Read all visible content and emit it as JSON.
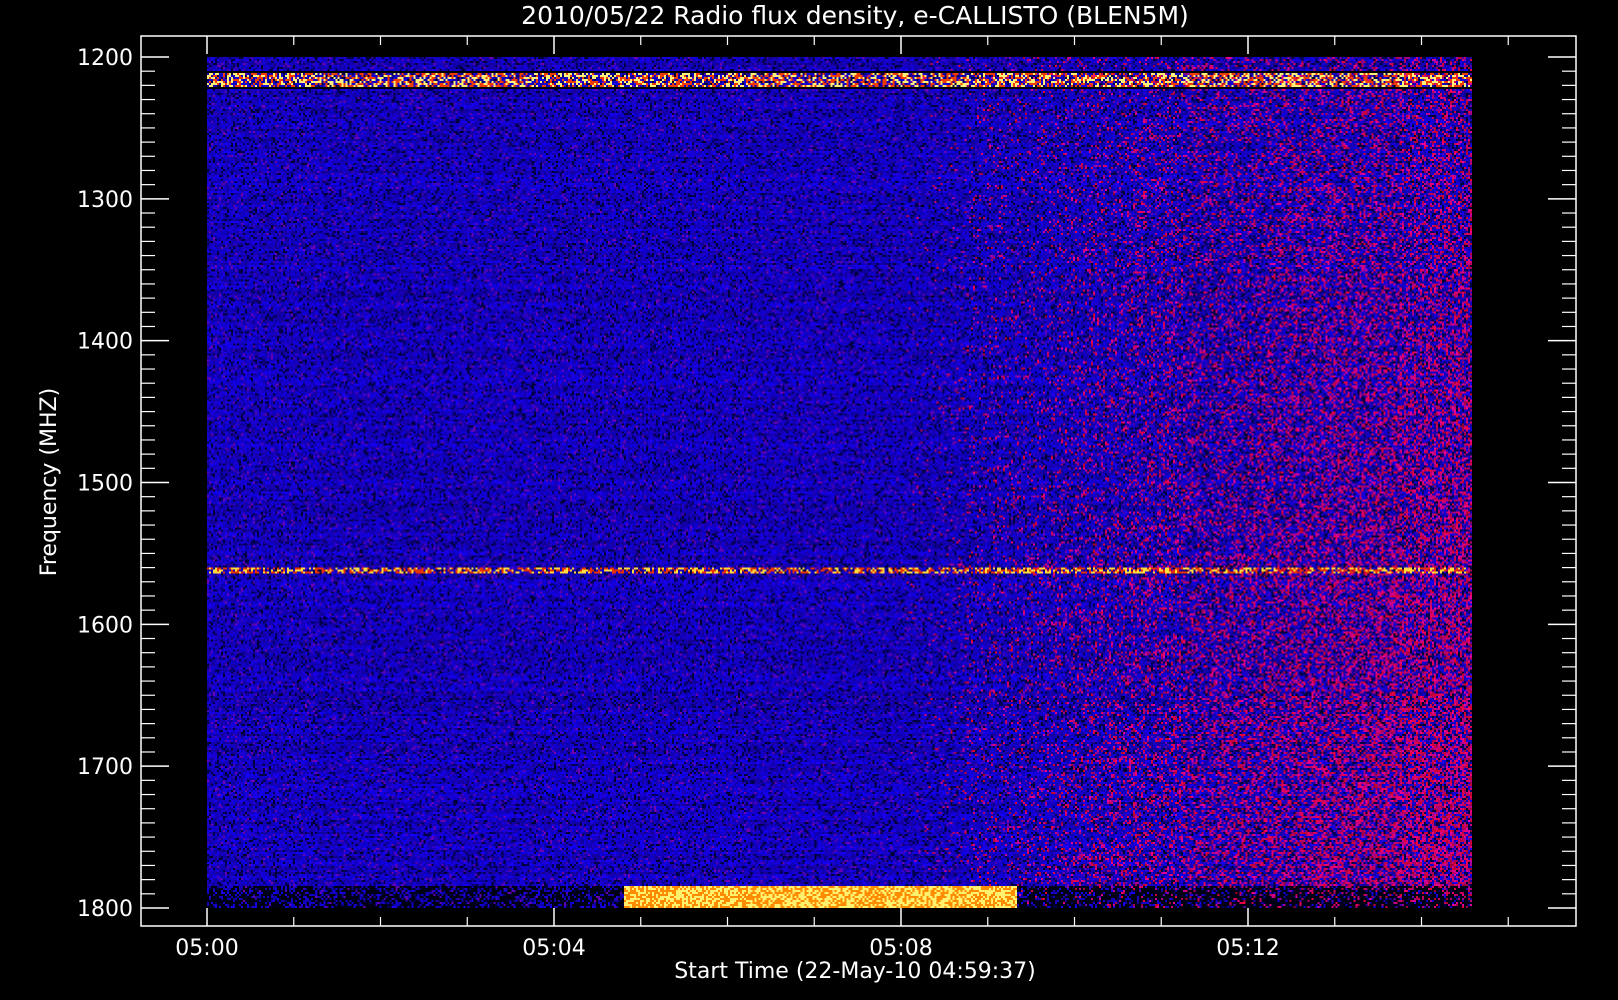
{
  "chart_data": {
    "type": "heatmap",
    "title": "2010/05/22  Radio flux density, e-CALLISTO (BLEN5M)",
    "xlabel": "Start Time (22-May-10 04:59:37)",
    "ylabel": "Frequency (MHZ)",
    "x_ticks": [
      "05:00",
      "05:04",
      "05:08",
      "05:12"
    ],
    "y_ticks": [
      1200,
      1300,
      1400,
      1500,
      1600,
      1700,
      1800
    ],
    "ylim": [
      1800,
      1200
    ],
    "y_direction": "increasing-downward",
    "colormap": [
      "#000000",
      "#0000ff",
      "#ff0000",
      "#ffff00",
      "#ffffff"
    ],
    "features": [
      {
        "frequency_mhz": 1215
      },
      {
        "frequency_mhz": 1562
      },
      {
        "frequency_mhz": 1797
      }
    ]
  }
}
